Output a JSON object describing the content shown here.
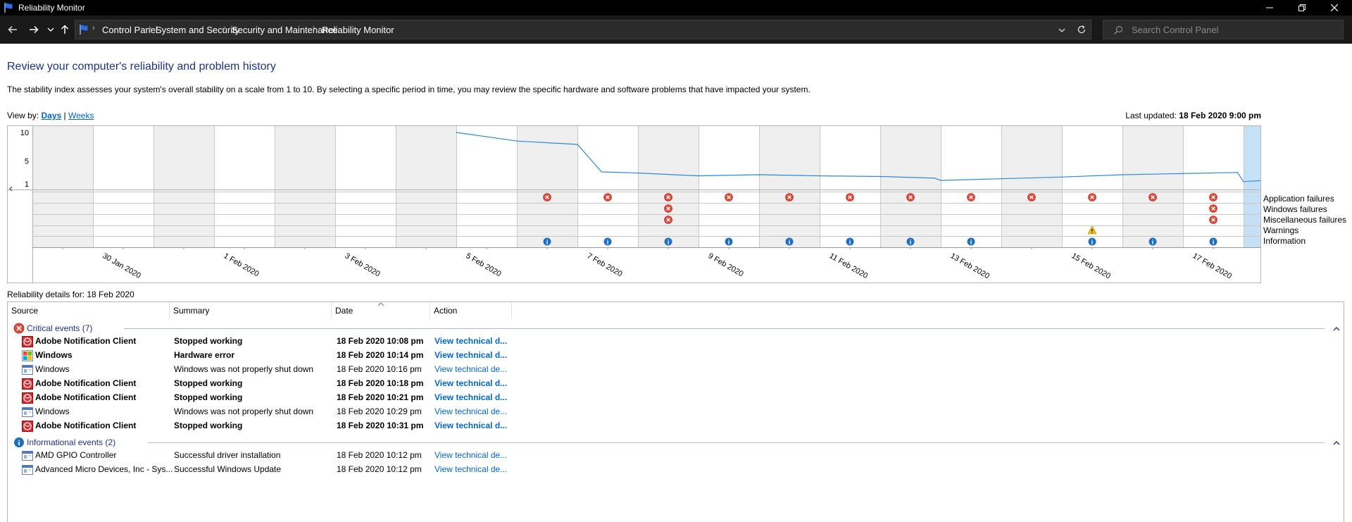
{
  "window": {
    "title": "Reliability Monitor"
  },
  "address": {
    "breadcrumbs": [
      "Control Panel",
      "System and Security",
      "Security and Maintenance",
      "Reliability Monitor"
    ],
    "search_placeholder": "Search Control Panel"
  },
  "page": {
    "heading": "Review your computer's reliability and problem history",
    "description": "The stability index assesses your system's overall stability on a scale from 1 to 10. By selecting a specific period in time, you may review the specific hardware and software problems that have impacted your system.",
    "view_by_label": "View by:",
    "view_days": "Days",
    "view_sep": "|",
    "view_weeks": "Weeks",
    "last_updated_label": "Last updated:",
    "last_updated_value": "18 Feb 2020 9:00 pm",
    "details_for": "Reliability details for: 18 Feb 2020"
  },
  "chart_data": {
    "type": "line",
    "y_ticks": [
      "10",
      "5",
      "1"
    ],
    "ylim": [
      1,
      10
    ],
    "dates": [
      "29 Jan 2020",
      "30 Jan 2020",
      "31 Jan 2020",
      "1 Feb 2020",
      "2 Feb 2020",
      "3 Feb 2020",
      "4 Feb 2020",
      "5 Feb 2020",
      "6 Feb 2020",
      "7 Feb 2020",
      "8 Feb 2020",
      "9 Feb 2020",
      "10 Feb 2020",
      "11 Feb 2020",
      "12 Feb 2020",
      "13 Feb 2020",
      "14 Feb 2020",
      "15 Feb 2020",
      "16 Feb 2020",
      "17 Feb 2020",
      "18 Feb 2020"
    ],
    "x_tick_labels": [
      "30 Jan 2020",
      "1 Feb 2020",
      "3 Feb 2020",
      "5 Feb 2020",
      "7 Feb 2020",
      "9 Feb 2020",
      "11 Feb 2020",
      "13 Feb 2020",
      "15 Feb 2020",
      "17 Feb 2020"
    ],
    "selected_index": 20,
    "stability_index": [
      {
        "day": 7,
        "value": 10.0
      },
      {
        "day": 8,
        "value": 8.5
      },
      {
        "day": 9,
        "value": 7.9
      },
      {
        "day": 9.4,
        "value": 3.1
      },
      {
        "day": 10,
        "value": 2.9
      },
      {
        "day": 11,
        "value": 2.4
      },
      {
        "day": 12,
        "value": 2.6
      },
      {
        "day": 13,
        "value": 2.4
      },
      {
        "day": 14,
        "value": 2.3
      },
      {
        "day": 14.9,
        "value": 2.0
      },
      {
        "day": 15,
        "value": 1.6
      },
      {
        "day": 16,
        "value": 1.9
      },
      {
        "day": 17,
        "value": 2.2
      },
      {
        "day": 18,
        "value": 2.6
      },
      {
        "day": 19,
        "value": 2.8
      },
      {
        "day": 19.9,
        "value": 3.0
      },
      {
        "day": 20.0,
        "value": 1.4
      },
      {
        "day": 21.0,
        "value": 2.0
      }
    ],
    "rows": [
      "Application failures",
      "Windows failures",
      "Miscellaneous failures",
      "Warnings",
      "Information"
    ],
    "events": {
      "Application failures": [
        8,
        9,
        10,
        11,
        12,
        13,
        14,
        15,
        16,
        17,
        18,
        19,
        20
      ],
      "Windows failures": [
        10,
        19,
        20
      ],
      "Miscellaneous failures": [
        10,
        19,
        20
      ],
      "Warnings": [
        17
      ],
      "Information": [
        8,
        9,
        10,
        11,
        12,
        13,
        14,
        15,
        17,
        18,
        19,
        20
      ]
    },
    "colors": {
      "line": "#2e8ad8",
      "selected": "#c6e0f6",
      "shaded": "#efefef",
      "error": "#e04a3a",
      "info": "#1f6fc0",
      "warning": "#f0c000"
    }
  },
  "table": {
    "columns": [
      "Source",
      "Summary",
      "Date",
      "Action"
    ],
    "groups": [
      {
        "label": "Critical events (7)",
        "icon": "error-icon",
        "rows": [
          {
            "source": "Adobe Notification Client",
            "summary": "Stopped working",
            "date": "18 Feb 2020 10:08 pm",
            "action": "View technical d...",
            "bold": true,
            "icon": "adobe-icon"
          },
          {
            "source": "Windows",
            "summary": "Hardware error",
            "date": "18 Feb 2020 10:14 pm",
            "action": "View technical d...",
            "bold": true,
            "icon": "windows-icon"
          },
          {
            "source": "Windows",
            "summary": "Windows was not properly shut down",
            "date": "18 Feb 2020 10:16 pm",
            "action": "View technical de...",
            "bold": false,
            "icon": "window-icon"
          },
          {
            "source": "Adobe Notification Client",
            "summary": "Stopped working",
            "date": "18 Feb 2020 10:18 pm",
            "action": "View technical d...",
            "bold": true,
            "icon": "adobe-icon"
          },
          {
            "source": "Adobe Notification Client",
            "summary": "Stopped working",
            "date": "18 Feb 2020 10:21 pm",
            "action": "View technical d...",
            "bold": true,
            "icon": "adobe-icon"
          },
          {
            "source": "Windows",
            "summary": "Windows was not properly shut down",
            "date": "18 Feb 2020 10:29 pm",
            "action": "View technical de...",
            "bold": false,
            "icon": "window-icon"
          },
          {
            "source": "Adobe Notification Client",
            "summary": "Stopped working",
            "date": "18 Feb 2020 10:31 pm",
            "action": "View technical d...",
            "bold": true,
            "icon": "adobe-icon"
          }
        ]
      },
      {
        "label": "Informational events (2)",
        "icon": "info-icon",
        "rows": [
          {
            "source": "AMD GPIO Controller",
            "summary": "Successful driver installation",
            "date": "18 Feb 2020 10:12 pm",
            "action": "View technical de...",
            "bold": false,
            "icon": "window-icon"
          },
          {
            "source": "Advanced Micro Devices, Inc - Sys...",
            "summary": "Successful Windows Update",
            "date": "18 Feb 2020 10:12 pm",
            "action": "View technical de...",
            "bold": false,
            "icon": "window-icon"
          }
        ]
      }
    ]
  }
}
